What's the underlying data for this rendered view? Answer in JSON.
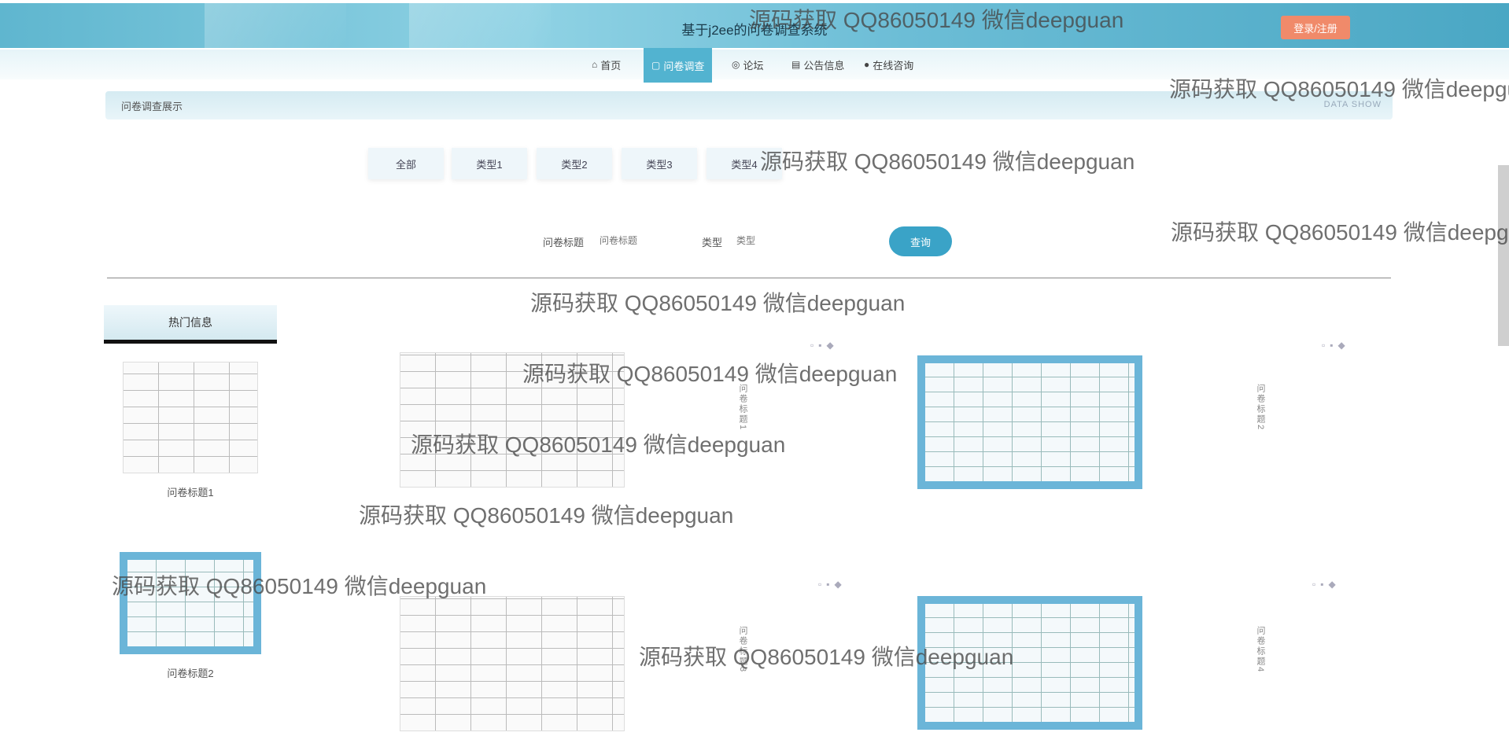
{
  "header": {
    "site_title": "基于j2ee的问卷调查系统",
    "login_label": "登录/注册"
  },
  "nav": {
    "items": [
      {
        "label": "首页",
        "icon": "home-icon"
      },
      {
        "label": "问卷调查",
        "icon": "survey-icon",
        "active": true
      },
      {
        "label": "论坛",
        "icon": "forum-icon"
      },
      {
        "label": "公告信息",
        "icon": "notice-icon"
      },
      {
        "label": "在线咨询",
        "icon": "chat-icon"
      }
    ]
  },
  "breadcrumb": {
    "text": "问卷调查展示",
    "english": "DATA SHOW"
  },
  "categories": [
    "全部",
    "类型1",
    "类型2",
    "类型3",
    "类型4"
  ],
  "search": {
    "title_label": "问卷标题",
    "title_placeholder": "问卷标题",
    "type_label": "类型",
    "type_placeholder": "类型",
    "button_label": "查询"
  },
  "sidebar": {
    "heading": "热门信息",
    "cards": [
      {
        "caption": "问卷标题1"
      },
      {
        "caption": "问卷标题2"
      }
    ]
  },
  "grid": {
    "items": [
      {
        "vertical_label": "问卷标题1"
      },
      {
        "vertical_label": "问卷标题2"
      },
      {
        "vertical_label": "问卷标题3"
      },
      {
        "vertical_label": "问卷标题4"
      }
    ]
  },
  "watermark": "源码获取 QQ86050149 微信deepguan",
  "colors": {
    "banner": "#6cbdd6",
    "nav_active": "#52b3d0",
    "login_button": "#f08a6a",
    "search_button": "#3aa3c7"
  }
}
